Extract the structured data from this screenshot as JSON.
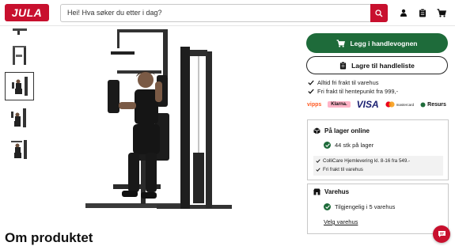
{
  "header": {
    "logo_text": "JULA",
    "search_value": "Hei! Hva søker du etter i dag?"
  },
  "product": {
    "section_heading": "Om produktet"
  },
  "actions": {
    "add_to_cart": "Legg i handlevognen",
    "save_to_list": "Lagre til handleliste"
  },
  "usps": [
    "Alltid fri frakt til varehus",
    "Fri frakt til hentepunkt fra 999,-"
  ],
  "payments": [
    "vipps",
    "Klarna.",
    "VISA",
    "mastercard",
    "Resurs"
  ],
  "online": {
    "title": "På lager online",
    "stock": "44 stk på lager",
    "shipping": [
      "ColliCare Hjemlevering kl. 8-16 fra 549.-",
      "Fri frakt til varehus"
    ]
  },
  "store": {
    "title": "Varehus",
    "availability": "Tilgjengelig i 5 varehus",
    "link": "Velg varehus"
  },
  "colors": {
    "brand_red": "#c8102e",
    "action_green": "#1e6b3a"
  }
}
